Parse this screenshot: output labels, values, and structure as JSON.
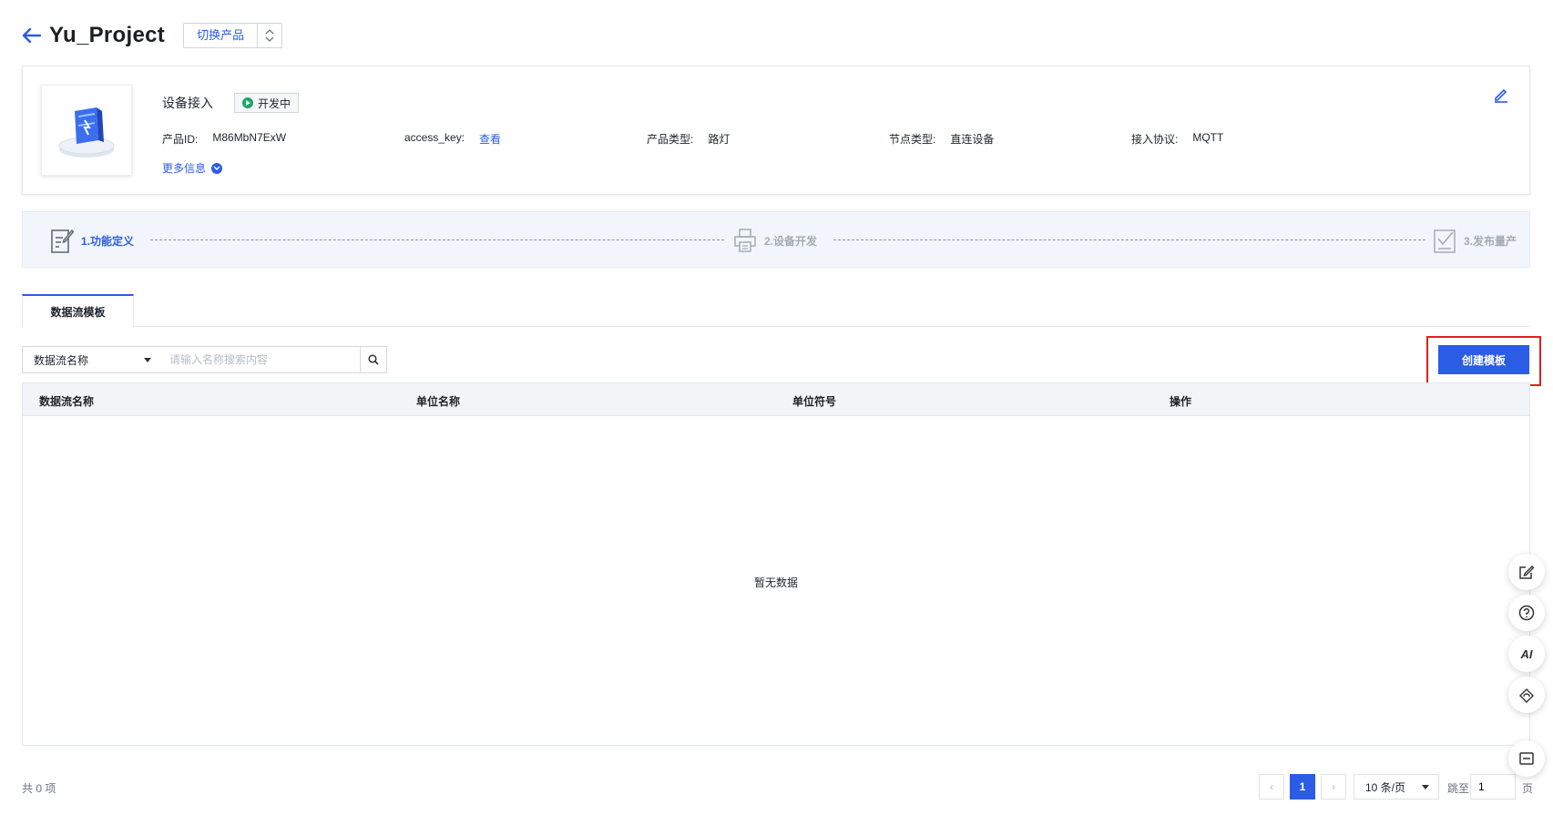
{
  "header": {
    "title": "Yu_Project",
    "switch_label": "切换产品"
  },
  "product": {
    "name": "设备接入",
    "status": "开发中",
    "meta": [
      {
        "key": "产品ID:",
        "value": "M86MbN7ExW"
      },
      {
        "key": "access_key:",
        "value": "查看"
      },
      {
        "key": "产品类型:",
        "value": "路灯"
      },
      {
        "key": "节点类型:",
        "value": "直连设备"
      },
      {
        "key": "接入协议:",
        "value": "MQTT"
      }
    ],
    "more_info": "更多信息"
  },
  "steps": [
    {
      "label": "1.功能定义",
      "active": true
    },
    {
      "label": "2.设备开发",
      "active": false
    },
    {
      "label": "3.发布量产",
      "active": false
    }
  ],
  "tabs": [
    {
      "label": "数据流模板"
    }
  ],
  "toolbar": {
    "filter_selected": "数据流名称",
    "search_placeholder": "请输入名称搜索内容",
    "create_label": "创建模板"
  },
  "table": {
    "columns": [
      "数据流名称",
      "单位名称",
      "单位符号",
      "操作"
    ],
    "rows": [],
    "empty_text": "暂无数据"
  },
  "pagination": {
    "total_text": "共 0 项",
    "prev": "‹",
    "current_page": "1",
    "next": "›",
    "page_size": "10 条/页",
    "jump_label": "跳至",
    "jump_value": "1",
    "page_unit": "页"
  },
  "float_tools": [
    {
      "icon": "edit-note-icon"
    },
    {
      "icon": "help-icon"
    },
    {
      "icon": "ai-icon",
      "text": "AI"
    },
    {
      "icon": "cloud-service-icon"
    },
    {
      "icon": "collapse-icon"
    }
  ],
  "colors": {
    "accent": "#2b5ce6",
    "success": "#19a862",
    "highlight": "#e02020"
  }
}
